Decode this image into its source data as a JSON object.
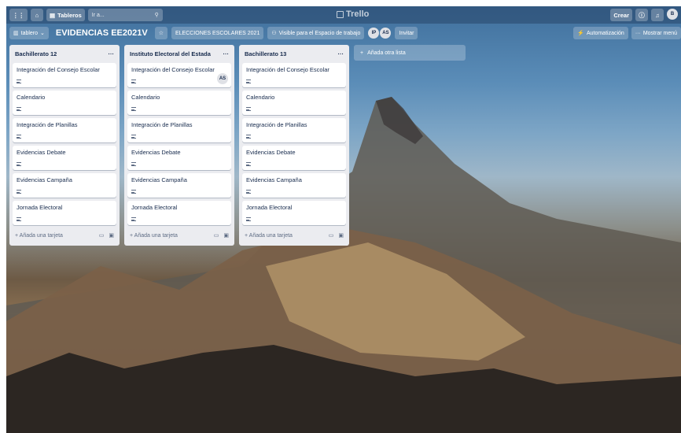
{
  "topbar": {
    "boards_label": "Tableros",
    "search_placeholder": "Ir a...",
    "logo": "Trello",
    "create_label": "Crear",
    "user_initial": "B"
  },
  "board": {
    "view_label": "tablero",
    "title": "EVIDENCIAS EE2021V",
    "team_label": "ELECCIONES ESCOLARES 2021",
    "visibility_label": "Visible para el Espacio de trabajo",
    "members": [
      "IP",
      "AS"
    ],
    "invite_label": "Invitar",
    "automation_label": "Automatización",
    "menu_label": "Mostrar menú"
  },
  "lists": [
    {
      "title": "Bachillerato 12",
      "cards": [
        {
          "title": "Integración del Consejo Escolar",
          "member": ""
        },
        {
          "title": "Calendario",
          "member": ""
        },
        {
          "title": "Integración de Planillas",
          "member": ""
        },
        {
          "title": "Evidencias Debate",
          "member": ""
        },
        {
          "title": "Evidencias Campaña",
          "member": ""
        },
        {
          "title": "Jornada Electoral",
          "member": ""
        }
      ],
      "add_card_label": "Añada una tarjeta"
    },
    {
      "title": "Instituto Electoral del Estada",
      "cards": [
        {
          "title": "Integración del Consejo Escolar",
          "member": "AS"
        },
        {
          "title": "Calendario",
          "member": ""
        },
        {
          "title": "Integración de Planillas",
          "member": ""
        },
        {
          "title": "Evidencias Debate",
          "member": ""
        },
        {
          "title": "Evidencias Campaña",
          "member": ""
        },
        {
          "title": "Jornada Electoral",
          "member": ""
        }
      ],
      "add_card_label": "Añada una tarjeta"
    },
    {
      "title": "Bachillerato 13",
      "cards": [
        {
          "title": "Integración del Consejo Escolar",
          "member": ""
        },
        {
          "title": "Calendario",
          "member": ""
        },
        {
          "title": "Integración de Planillas",
          "member": ""
        },
        {
          "title": "Evidencias Debate",
          "member": ""
        },
        {
          "title": "Evidencias Campaña",
          "member": ""
        },
        {
          "title": "Jornada Electoral",
          "member": ""
        }
      ],
      "add_card_label": "Añada una tarjeta"
    }
  ],
  "add_list_label": "Añada otra lista",
  "icons": {
    "apps": "grid-icon",
    "home": "home-icon",
    "boards": "board-icon",
    "search": "search-icon",
    "info": "info-icon",
    "bell": "bell-icon",
    "star": "star-icon",
    "plus": "plus-icon",
    "more": "more-icon"
  }
}
